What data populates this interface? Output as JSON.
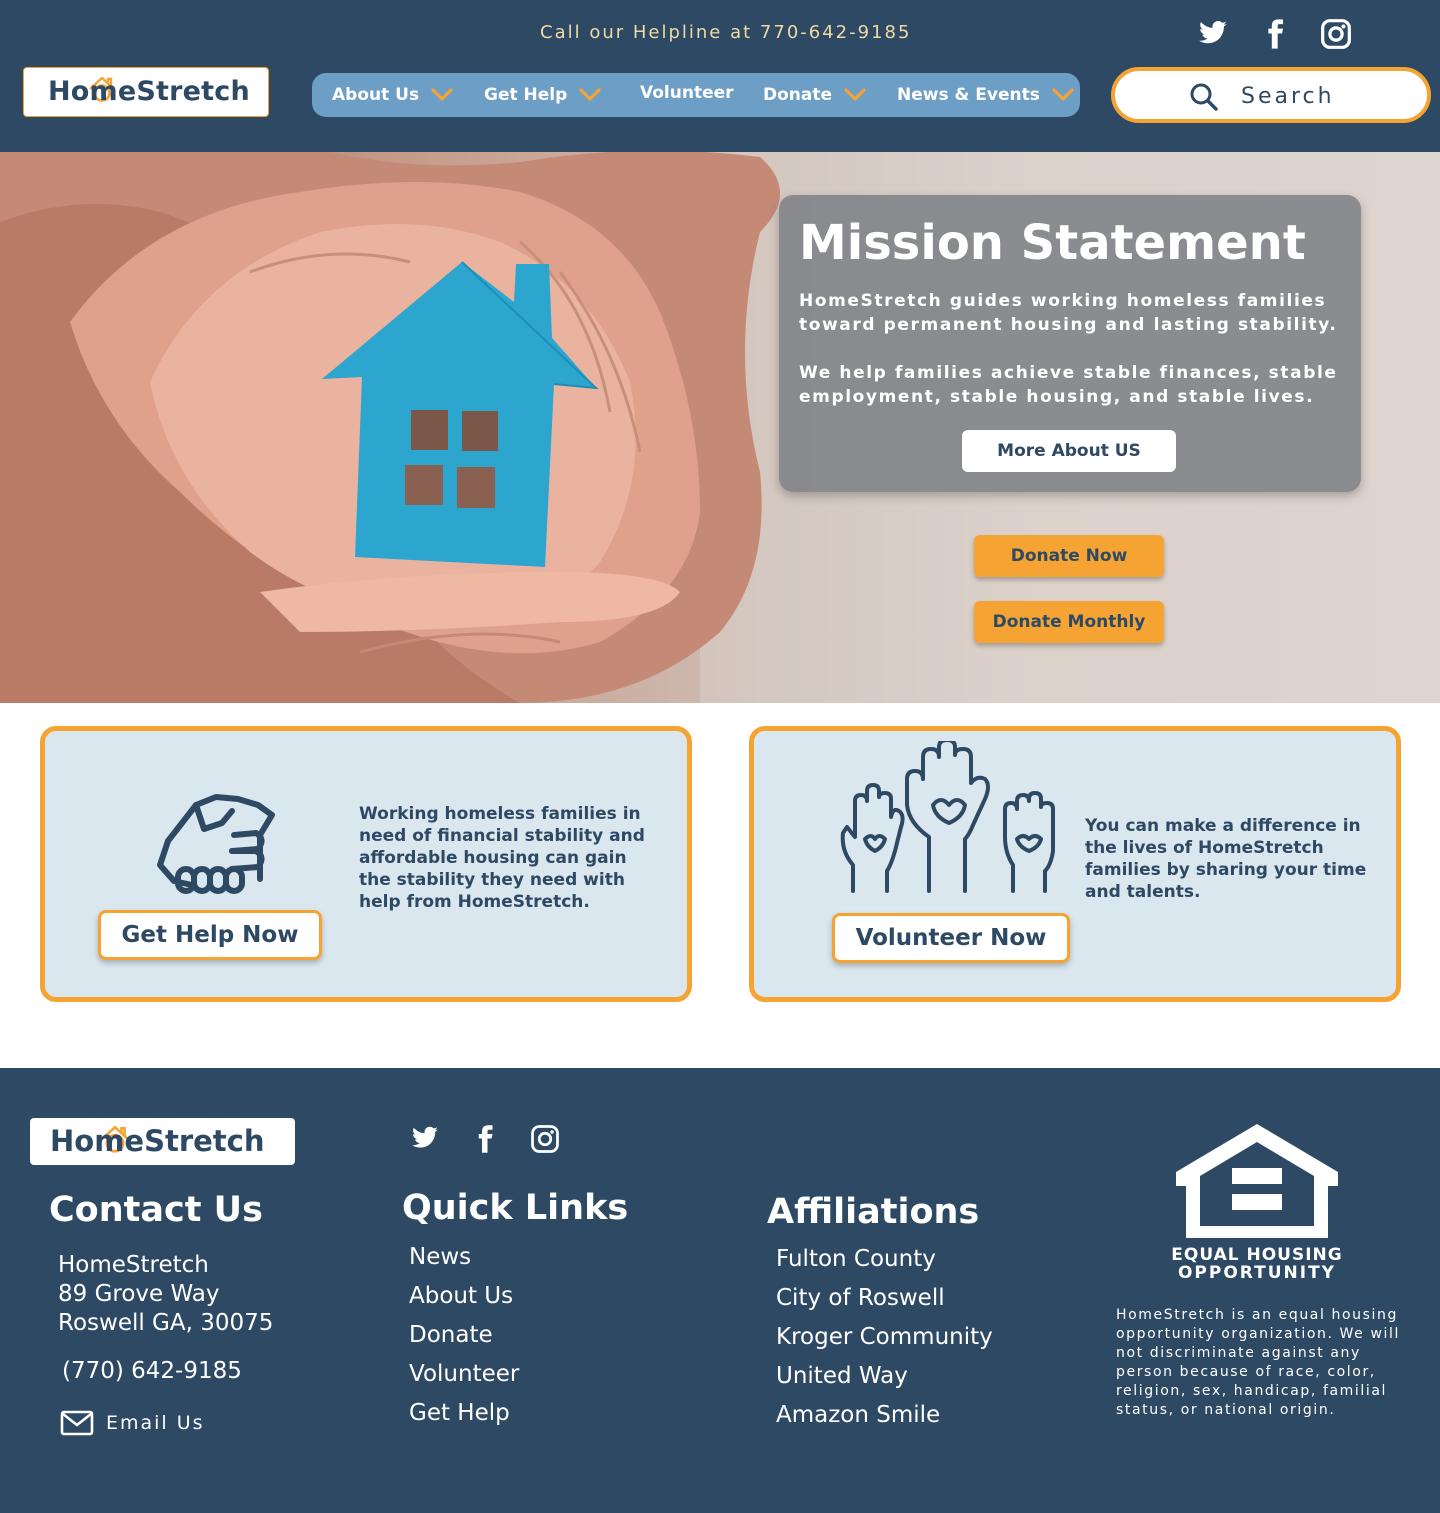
{
  "header": {
    "helpline": "Call our Helpline at 770-642-9185",
    "logo": "HomeStretch",
    "nav": [
      {
        "label": "About Us",
        "has_dropdown": true
      },
      {
        "label": "Get Help",
        "has_dropdown": true
      },
      {
        "label": "Volunteer",
        "has_dropdown": false
      },
      {
        "label": "Donate",
        "has_dropdown": true
      },
      {
        "label": "News & Events",
        "has_dropdown": true
      }
    ],
    "search_label": "Search",
    "social_icons": [
      "twitter-icon",
      "facebook-icon",
      "instagram-icon"
    ]
  },
  "hero": {
    "mission_title": "Mission Statement",
    "mission_p1": "HomeStretch guides working homeless families toward permanent housing and lasting stability.",
    "mission_p2": "We help families achieve stable finances, stable employment, stable housing, and stable lives.",
    "more_button": "More About US",
    "donate_now": "Donate Now",
    "donate_monthly": "Donate Monthly"
  },
  "cards": {
    "help": {
      "icon": "handshake-icon",
      "text": "Working homeless families in need of financial stability and affordable housing can gain the stability they need with help from HomeStretch.",
      "button": "Get Help Now"
    },
    "volunteer": {
      "icon": "raised-hands-heart-icon",
      "text": "You can make a difference in the lives of HomeStretch families by sharing your time and talents.",
      "button": "Volunteer Now"
    }
  },
  "footer": {
    "logo": "HomeStretch",
    "contact": {
      "heading": "Contact Us",
      "name": "HomeStretch",
      "street": "89 Grove Way",
      "city": "Roswell GA, 30075",
      "phone": "(770) 642-9185",
      "email_label": "Email Us"
    },
    "quick_links": {
      "heading": "Quick Links",
      "items": [
        "News",
        "About Us",
        "Donate",
        "Volunteer",
        "Get Help"
      ]
    },
    "affiliations": {
      "heading": "Affiliations",
      "items": [
        "Fulton County",
        "City of Roswell",
        "Kroger Community",
        "United Way",
        "Amazon Smile"
      ]
    },
    "eho": {
      "line1": "EQUAL HOUSING",
      "line2": "OPPORTUNITY",
      "statement": "HomeStretch is an equal housing opportunity organization. We will not discriminate against any person because of race, color, religion, sex, handicap, familial status, or national origin."
    }
  },
  "colors": {
    "navy": "#2e4964",
    "orange": "#f5a433",
    "nav_blue": "#6d9ec5",
    "card_bg": "#dbe7ef",
    "house_blue": "#2ca6cf"
  }
}
